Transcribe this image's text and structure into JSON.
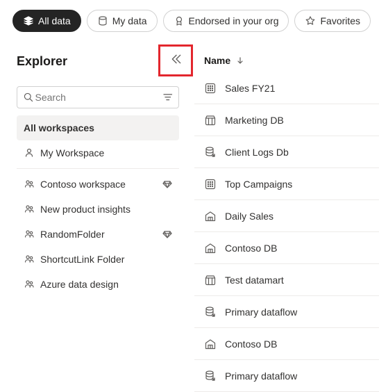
{
  "filters": {
    "all_data": "All data",
    "my_data": "My data",
    "endorsed": "Endorsed in your org",
    "favorites": "Favorites"
  },
  "explorer": {
    "title": "Explorer",
    "search_placeholder": "Search",
    "all_workspaces": "All workspaces",
    "items": [
      {
        "label": "My Workspace",
        "icon": "person",
        "endorsed": false
      },
      {
        "label": "Contoso workspace",
        "icon": "group",
        "endorsed": true
      },
      {
        "label": "New product insights",
        "icon": "group",
        "endorsed": false
      },
      {
        "label": "RandomFolder",
        "icon": "group",
        "endorsed": true
      },
      {
        "label": "ShortcutLink Folder",
        "icon": "group",
        "endorsed": false
      },
      {
        "label": "Azure data design",
        "icon": "group",
        "endorsed": false
      }
    ]
  },
  "table": {
    "column": "Name",
    "rows": [
      {
        "label": "Sales FY21",
        "icon": "dataset"
      },
      {
        "label": "Marketing DB",
        "icon": "datamart"
      },
      {
        "label": "Client Logs Db",
        "icon": "dataflow"
      },
      {
        "label": "Top Campaigns",
        "icon": "dataset"
      },
      {
        "label": "Daily Sales",
        "icon": "warehouse"
      },
      {
        "label": "Contoso DB",
        "icon": "warehouse"
      },
      {
        "label": "Test datamart",
        "icon": "datamart"
      },
      {
        "label": "Primary dataflow",
        "icon": "dataflow"
      },
      {
        "label": "Contoso DB",
        "icon": "warehouse"
      },
      {
        "label": "Primary dataflow",
        "icon": "dataflow"
      }
    ]
  }
}
